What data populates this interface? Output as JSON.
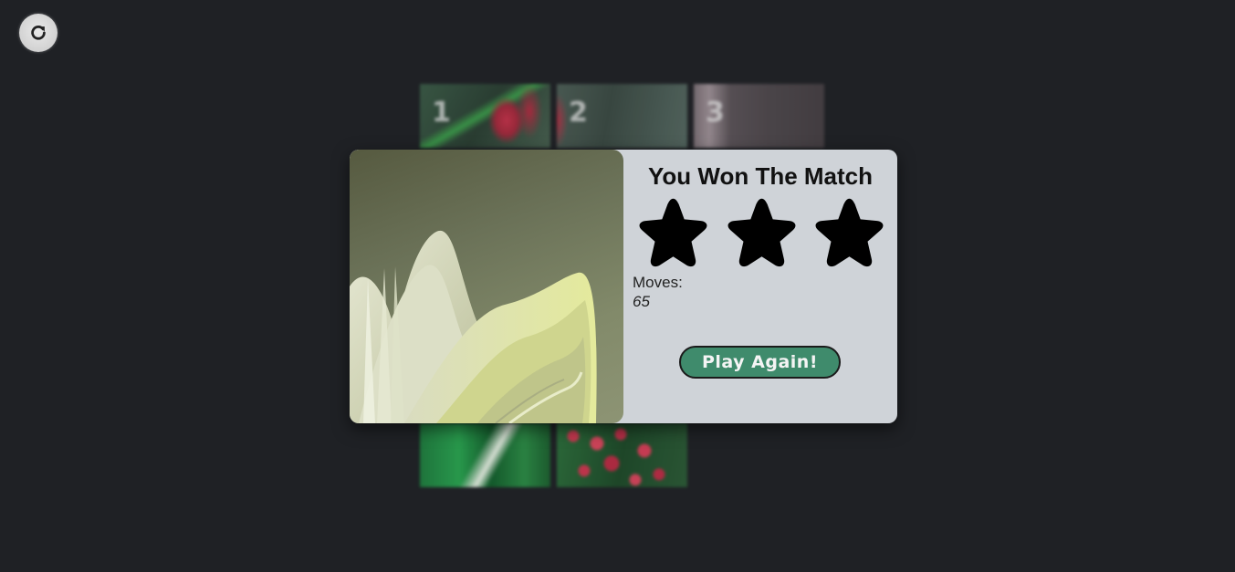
{
  "toolbar": {
    "refresh_icon": "refresh-icon"
  },
  "board": {
    "tiles": [
      {
        "number": "1"
      },
      {
        "number": "2"
      },
      {
        "number": "3"
      }
    ]
  },
  "modal": {
    "title": "You Won The Match",
    "stars_earned": 3,
    "stars_total": 3,
    "moves_label": "Moves:",
    "moves_value": "65",
    "button_label": "Play Again!",
    "button_color": "#3f8b6c",
    "panel_color": "#cfd3d8"
  },
  "colors": {
    "background": "#1f2125",
    "star": "#000000"
  }
}
